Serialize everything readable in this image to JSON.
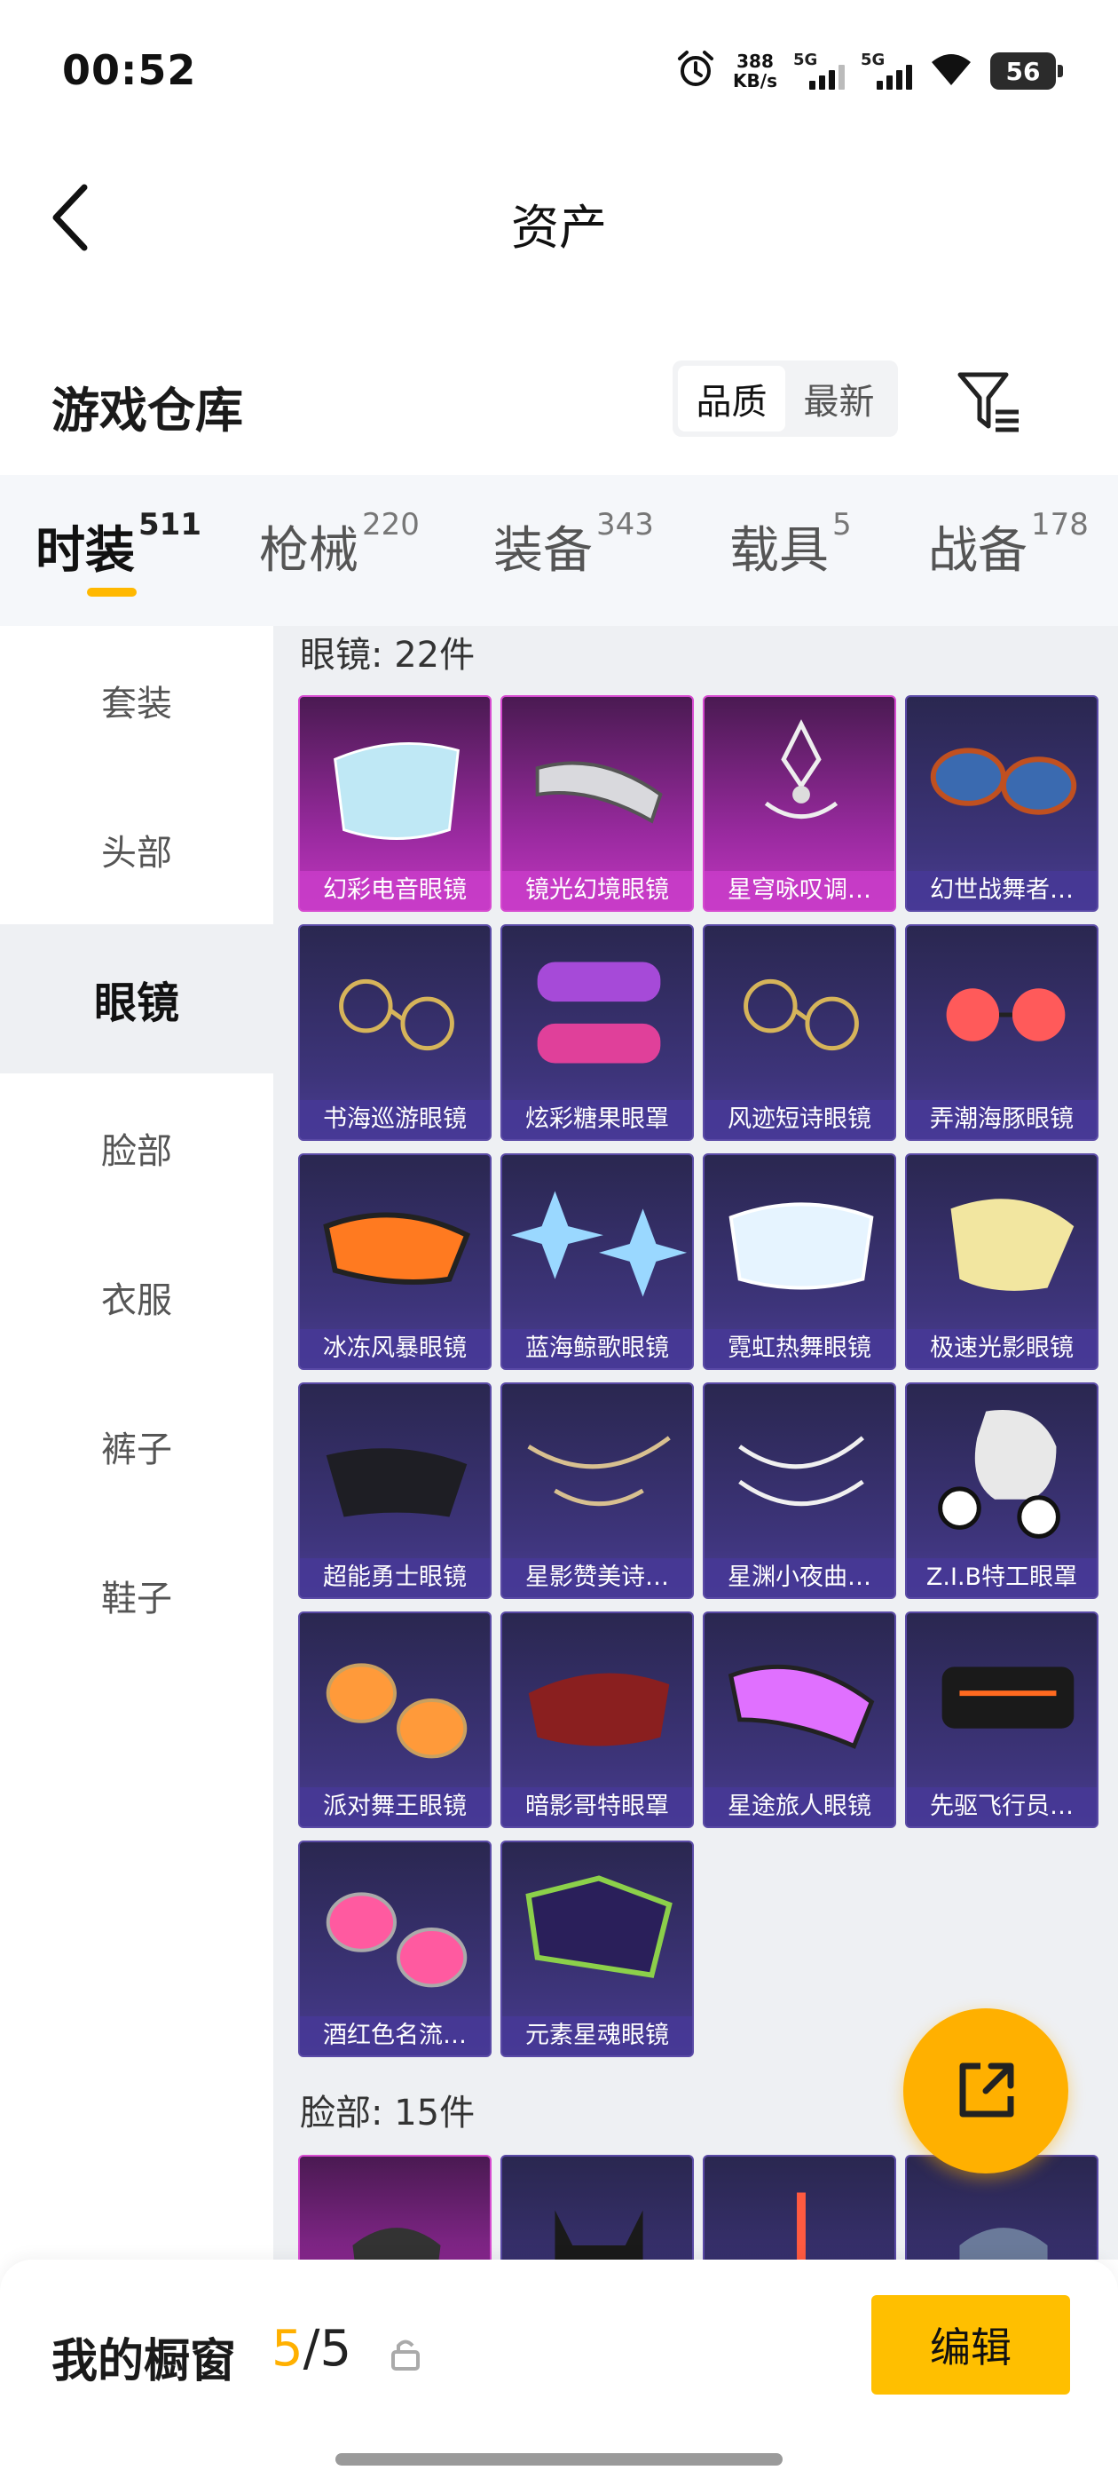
{
  "status_bar": {
    "time": "00:52",
    "speed_value": "388",
    "speed_unit": "KB/s",
    "net1": "5G",
    "net2": "5G",
    "battery": "56"
  },
  "header": {
    "title": "资产"
  },
  "warehouse": {
    "title": "游戏仓库",
    "sort_options": [
      "品质",
      "最新"
    ],
    "sort_active": "品质"
  },
  "tabs": [
    {
      "label": "时装",
      "count": "511"
    },
    {
      "label": "枪械",
      "count": "220"
    },
    {
      "label": "装备",
      "count": "343"
    },
    {
      "label": "载具",
      "count": "5"
    },
    {
      "label": "战备",
      "count": "178"
    }
  ],
  "sidebar": [
    {
      "label": "套装"
    },
    {
      "label": "头部"
    },
    {
      "label": "眼镜"
    },
    {
      "label": "脸部"
    },
    {
      "label": "衣服"
    },
    {
      "label": "裤子"
    },
    {
      "label": "鞋子"
    }
  ],
  "sections": {
    "glasses_label": "眼镜: 22件",
    "face_label": "脸部: 15件"
  },
  "glasses_items": [
    {
      "name": "幻彩电音眼镜",
      "rarity": "pink",
      "icon": "visor-icon"
    },
    {
      "name": "镜光幻境眼镜",
      "rarity": "pink",
      "icon": "band-visor-icon"
    },
    {
      "name": "星穹咏叹调…",
      "rarity": "pink",
      "icon": "ornate-mask-icon"
    },
    {
      "name": "幻世战舞者…",
      "rarity": "purple",
      "icon": "sunglasses-icon"
    },
    {
      "name": "书海巡游眼镜",
      "rarity": "purple",
      "icon": "round-glasses-icon"
    },
    {
      "name": "炫彩糖果眼罩",
      "rarity": "purple",
      "icon": "candy-mask-icon"
    },
    {
      "name": "风迹短诗眼镜",
      "rarity": "purple",
      "icon": "round-glasses-icon"
    },
    {
      "name": "弄潮海豚眼镜",
      "rarity": "purple",
      "icon": "red-round-glasses-icon"
    },
    {
      "name": "冰冻风暴眼镜",
      "rarity": "purple",
      "icon": "sport-glasses-icon"
    },
    {
      "name": "蓝海鲸歌眼镜",
      "rarity": "purple",
      "icon": "star-glasses-icon"
    },
    {
      "name": "霓虹热舞眼镜",
      "rarity": "purple",
      "icon": "goggles-icon"
    },
    {
      "name": "极速光影眼镜",
      "rarity": "purple",
      "icon": "honeycomb-visor-icon"
    },
    {
      "name": "超能勇士眼镜",
      "rarity": "purple",
      "icon": "hero-mask-icon"
    },
    {
      "name": "星影赞美诗…",
      "rarity": "purple",
      "icon": "chain-glasses-icon"
    },
    {
      "name": "星渊小夜曲…",
      "rarity": "purple",
      "icon": "ornate-chain-icon"
    },
    {
      "name": "Z.I.B特工眼罩",
      "rarity": "purple",
      "icon": "skull-mask-icon"
    },
    {
      "name": "派对舞王眼镜",
      "rarity": "purple",
      "icon": "aviator-icon"
    },
    {
      "name": "暗影哥特眼罩",
      "rarity": "purple",
      "icon": "blindfold-icon"
    },
    {
      "name": "星途旅人眼镜",
      "rarity": "purple",
      "icon": "pink-visor-icon"
    },
    {
      "name": "先驱飞行员…",
      "rarity": "purple",
      "icon": "pilot-visor-icon"
    },
    {
      "name": "酒红色名流…",
      "rarity": "purple",
      "icon": "pink-aviator-icon"
    },
    {
      "name": "元素星魂眼镜",
      "rarity": "purple",
      "icon": "green-sunglasses-icon"
    }
  ],
  "face_items": [
    {
      "name": "",
      "rarity": "pink",
      "icon": "respirator-icon"
    },
    {
      "name": "",
      "rarity": "purple",
      "icon": "cat-mask-icon"
    },
    {
      "name": "",
      "rarity": "purple",
      "icon": "snorkel-icon"
    },
    {
      "name": "",
      "rarity": "purple",
      "icon": "face-wrap-icon"
    }
  ],
  "bottom": {
    "showcase_label": "我的橱窗",
    "showcase_current": "5",
    "showcase_total": "/5",
    "edit_label": "编辑"
  },
  "colors": {
    "accent": "#ffb800",
    "rarity_pink": "#c238c0",
    "rarity_purple": "#4a3d92"
  }
}
